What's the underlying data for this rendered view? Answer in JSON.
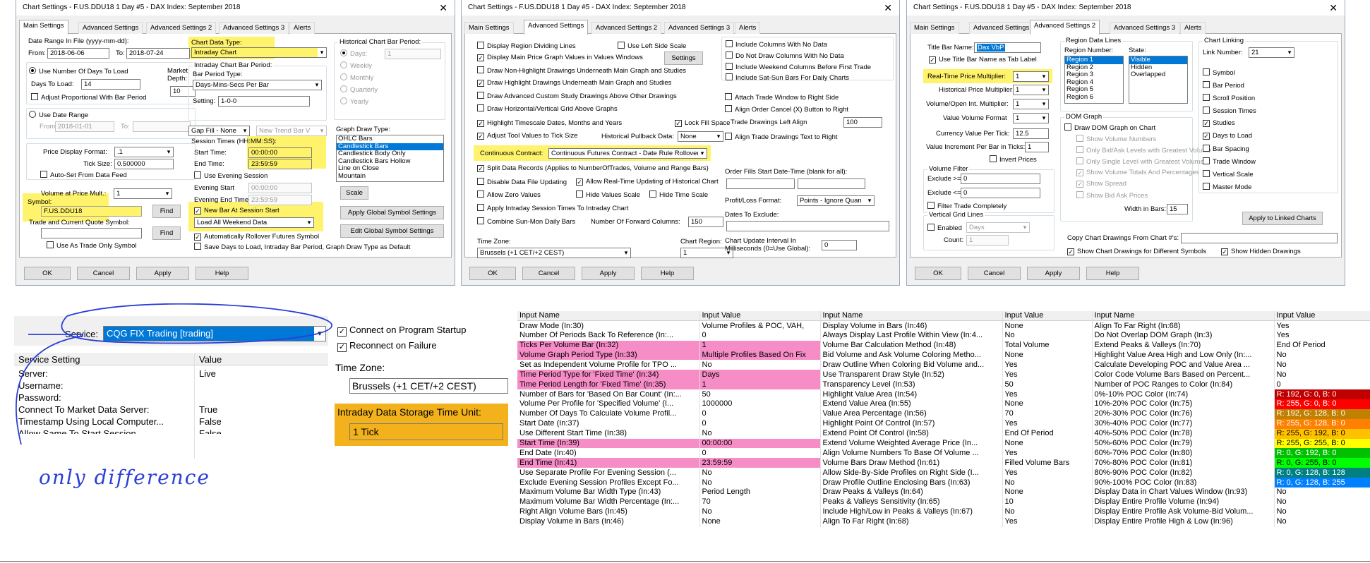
{
  "dialog_title": "Chart Settings - F.US.DDU18  1 Day  #5 - DAX Index: September 2018",
  "close_glyph": "✕",
  "tabs": [
    "Main Settings",
    "Advanced Settings",
    "Advanced Settings 2",
    "Advanced Settings 3",
    "Alerts"
  ],
  "buttons": {
    "ok": "OK",
    "cancel": "Cancel",
    "apply": "Apply",
    "help": "Help"
  },
  "highlight_color": "#fff36b",
  "pink_color": "#f78dc7",
  "d1": {
    "date_range_label": "Date Range In File (yyyy-mm-dd):",
    "from_label": "From:",
    "from_value": "2018-06-06",
    "to_label": "To:",
    "to_value": "2018-07-24",
    "use_days": "Use Number Of Days To Load",
    "days_to_load_label": "Days To Load:",
    "days_to_load": "14",
    "market_depth_label": "Market Depth:",
    "market_depth": "10",
    "adjust_prop": "Adjust Proportional With Bar Period",
    "use_date_range": "Use Date Range",
    "dr_from_label": "From:",
    "dr_from": "2018-01-01",
    "dr_to_label": "To:",
    "price_fmt_label": "Price Display Format:",
    "price_fmt": ".1",
    "tick_size_label": "Tick Size:",
    "tick_size": "0.500000",
    "auto_set": "Auto-Set From Data Feed",
    "vap_label": "Volume at Price Mult.:",
    "vap": "1",
    "symbol_label": "Symbol:",
    "symbol": "F.US.DDU18",
    "find": "Find",
    "trade_quote_label": "Trade and Current Quote Symbol:",
    "use_trade_only": "Use As Trade Only Symbol",
    "chart_data_type_label": "Chart Data Type:",
    "chart_data_type": "Intraday Chart",
    "intraday_period_label": "Intraday Chart Bar Period:",
    "bar_period_type_label": "Bar Period Type:",
    "bar_period_type": "Days-Mins-Secs Per Bar",
    "setting_label": "Setting:",
    "setting": "1-0-0",
    "gap_fill": "Gap Fill - None",
    "new_trend": "New Trend Bar V",
    "session_times_label": "Session Times (HH:MM:SS):",
    "start_time_label": "Start Time:",
    "start_time": "00:00:00",
    "end_time_label": "End Time:",
    "end_time": "23:59:59",
    "use_evening": "Use Evening Session",
    "evening_start_label": "Evening Start",
    "evening_start": "00:00:00",
    "evening_end_label": "Evening End Time:",
    "evening_end": "23:59:59",
    "new_bar": "New Bar At Session Start",
    "load_weekend": "Load All Weekend Data",
    "auto_rollover": "Automatically Rollover Futures Symbol",
    "save_days": "Save Days to Load, Intraday Bar Period, Graph Draw Type as Default",
    "hist_period_label": "Historical Chart Bar Period:",
    "hist_days_label": "Days:",
    "hist_days": "1",
    "hist_weekly": "Weekly",
    "hist_monthly": "Monthly",
    "hist_quarterly": "Quarterly",
    "hist_yearly": "Yearly",
    "graph_draw_label": "Graph Draw Type:",
    "graph_draw_items": [
      "OHLC Bars",
      "Candlestick Bars",
      "Candlestick Body Only",
      "Candlestick Bars Hollow",
      "Line on Close",
      "Mountain"
    ],
    "scale": "Scale",
    "apply_global": "Apply Global Symbol Settings",
    "edit_global": "Edit Global Symbol Settings"
  },
  "d2": {
    "checks": [
      "Display Region Dividing Lines",
      "Use Left Side Scale",
      "Display Main Price Graph Values in Values Windows",
      "Draw Non-Highlight Drawings Underneath Main Graph and Studies",
      "Draw Highlight Drawings Underneath Main Graph and Studies",
      "Draw Advanced Custom Study Drawings Above Other Drawings",
      "Draw Horizontal/Vertical Grid Above Graphs",
      "Highlight Timescale Dates, Months and Years",
      "Lock Fill Space",
      "Adjust Tool Values to Tick Size",
      "Split Data Records (Applies to NumberOfTrades, Volume and Range Bars)",
      "Disable Data File Updating",
      "Allow Real-Time Updating of Historical Chart",
      "Allow Zero Values",
      "Hide Values Scale",
      "Hide Time Scale",
      "Apply Intraday Session Times To Intraday Chart",
      "Combine Sun-Mon Daily Bars"
    ],
    "settings": "Settings",
    "hist_pullback_label": "Historical Pullback Data:",
    "hist_pullback": "None",
    "continuous_label": "Continuous Contract:",
    "continuous": "Continuous Futures Contract - Date Rule Rollover",
    "fwd_cols_label": "Number Of Forward Columns:",
    "fwd_cols": "150",
    "right_checks": [
      "Include Columns With No Data",
      "Do Not Draw Columns With No Data",
      "Include Weekend Columns Before First Trade",
      "Include Sat-Sun Bars For Daily Charts",
      "Attach Trade Window to Right Side",
      "Align Order Cancel (X) Button to Right",
      "Align Trade Drawings Text to Right"
    ],
    "trade_left_label": "Trade Drawings Left Align",
    "trade_left": "100",
    "order_fills_label": "Order Fills Start Date-Time (blank for all):",
    "pl_format_label": "Profit/Loss Format:",
    "pl_format": "Points - Ignore Quan",
    "dates_exclude_label": "Dates To Exclude:",
    "time_zone_label": "Time Zone:",
    "time_zone": "Brussels (+1 CET/+2 CEST)",
    "chart_region_label": "Chart Region:",
    "chart_region": "1",
    "update_interval_label": "Chart Update Interval In Milliseconds (0=Use Global):",
    "update_interval": "0"
  },
  "d3": {
    "title_bar_label": "Title Bar Name:",
    "title_bar": "Dax VbP",
    "use_title_tab": "Use Title Bar Name as Tab Label",
    "rt_mult_label": "Real-Time Price Multiplier:",
    "rt_mult": "1",
    "hist_mult_label": "Historical Price Multiplier:",
    "hist_mult": "1",
    "vol_oi_label": "Volume/Open Int. Multiplier:",
    "vol_oi": "1",
    "vol_fmt_label": "Value Volume Format",
    "vol_fmt": "1",
    "currency_label": "Currency Value Per Tick:",
    "currency": "12.5",
    "vol_inc_label": "Value Increment Per Bar in Ticks:",
    "vol_inc": "1",
    "invert": "Invert Prices",
    "vol_filter_label": "Volume Filter",
    "excl_ge_label": "Exclude >=",
    "excl_ge": "0",
    "excl_le_label": "Exclude <=",
    "excl_le": "0",
    "filter_complete": "Filter Trade Completely",
    "vgrid_label": "Vertical Grid Lines",
    "enabled": "Enabled",
    "vg_days": "Days",
    "count_label": "Count:",
    "count": "1",
    "region_lines_label": "Region Data Lines",
    "region_number_label": "Region Number:",
    "regions": [
      "Region 1",
      "Region 2",
      "Region 3",
      "Region 4",
      "Region 5",
      "Region 6"
    ],
    "state_label": "State:",
    "states": [
      "Visible",
      "Hidden",
      "Overlapped"
    ],
    "dom_graph_label": "DOM Graph",
    "dom_checks": [
      "Draw DOM Graph on Chart",
      "Show Volume Numbers",
      "Only Bid/Ask Levels with Greatest Volume",
      "Only Single Level with Greatest Volume",
      "Show Volume Totals And Percentages",
      "Show Spread",
      "Show Bid Ask Prices"
    ],
    "width_label": "Width in Bars:",
    "width": "15",
    "linking_label": "Chart Linking",
    "link_number_label": "Link Number:",
    "link_number": "21",
    "link_checks": [
      "Symbol",
      "Bar Period",
      "Scroll Position",
      "Session Times",
      "Studies",
      "Days to Load",
      "Bar Spacing",
      "Trade Window",
      "Vertical Scale",
      "Master Mode"
    ],
    "apply_linked": "Apply to Linked Charts",
    "copy_label": "Copy Chart Drawings From Chart #'s:",
    "show_diff": "Show Chart Drawings for Different Symbols",
    "show_hidden": "Show Hidden Drawings"
  },
  "service": {
    "service_label": "Service:",
    "service_value": "CQG FIX Trading   [trading]",
    "col1": "Service Setting",
    "col2": "Value",
    "rows": [
      [
        "Server:",
        "Live"
      ],
      [
        "Username:",
        ""
      ],
      [
        "Password:",
        ""
      ],
      [
        "Connect To Market Data Server:",
        "True"
      ],
      [
        "Timestamp Using Local Computer...",
        "False"
      ],
      [
        "Allow Same To Start Session",
        "False"
      ]
    ],
    "connect_startup": "Connect on Program Startup",
    "reconnect": "Reconnect on Failure",
    "tz_label": "Time Zone:",
    "tz_value": "Brussels (+1 CET/+2 CEST)",
    "storage_label": "Intraday Data Storage Time Unit:",
    "storage_value": "1 Tick",
    "storage_color": "#f3b21b",
    "annotation": "only difference"
  },
  "inputs": {
    "headers": [
      "Input Name",
      "Input Value",
      "Input Name",
      "Input Value",
      "Input Name",
      "Input Value"
    ],
    "col1": [
      [
        "Draw Mode  (In:30)",
        "Volume Profiles & POC, VAH,"
      ],
      [
        "Number Of Periods Back To Reference  (In:...",
        "0"
      ],
      [
        "Ticks Per Volume Bar  (In:32)",
        "1"
      ],
      [
        "Volume Graph Period Type  (In:33)",
        "Multiple Profiles Based On Fix"
      ],
      [
        "Set as Independent Volume Profile for TPO ...",
        "No"
      ],
      [
        "Time Period Type for 'Fixed Time'  (In:34)",
        "Days"
      ],
      [
        "Time Period Length for 'Fixed Time'  (In:35)",
        "1"
      ],
      [
        "Number of Bars for 'Based On Bar Count'  (In:...",
        "50"
      ],
      [
        "Volume Per Profile for 'Specified Volume'  (I...",
        "1000000"
      ],
      [
        "Number Of Days To Calculate Volume Profil...",
        "0"
      ],
      [
        "Start Date  (In:37)",
        "0"
      ],
      [
        "Use Different Start Time  (In:38)",
        "No"
      ],
      [
        "Start Time  (In:39)",
        "00:00:00"
      ],
      [
        "End Date  (In:40)",
        "0"
      ],
      [
        "End Time  (In:41)",
        "23:59:59"
      ],
      [
        "Use Separate Profile For Evening Session  (...",
        "No"
      ],
      [
        "Exclude Evening Session Profiles Except Fo...",
        "No"
      ],
      [
        "Maximum Volume Bar Width Type  (In:43)",
        "Period Length"
      ],
      [
        "Maximum Volume Bar Width Percentage  (In:...",
        "70"
      ],
      [
        "Right Align Volume Bars  (In:45)",
        "No"
      ],
      [
        "Display Volume in Bars  (In:46)",
        "None"
      ]
    ],
    "col2": [
      [
        "Display Volume in Bars  (In:46)",
        "None"
      ],
      [
        "Always Display Last Profile Within View  (In:4...",
        "No"
      ],
      [
        "Volume Bar Calculation Method  (In:48)",
        "Total Volume"
      ],
      [
        "Bid Volume and Ask Volume Coloring Metho...",
        "None"
      ],
      [
        "Draw Outline When Coloring Bid Volume and...",
        "Yes"
      ],
      [
        "Use Transparent Draw Style  (In:52)",
        "Yes"
      ],
      [
        "Transparency Level  (In:53)",
        "50"
      ],
      [
        "Highlight Value Area  (In:54)",
        "Yes"
      ],
      [
        "Extend Value Area  (In:55)",
        "None"
      ],
      [
        "Value Area Percentage  (In:56)",
        "70"
      ],
      [
        "Highlight Point Of Control  (In:57)",
        "Yes"
      ],
      [
        "Extend Point Of Control  (In:58)",
        "End Of Period"
      ],
      [
        "Extend Volume Weighted Average Price  (In...",
        "None"
      ],
      [
        "Align Volume Numbers To Base Of Volume ...",
        "Yes"
      ],
      [
        "Volume Bars Draw Method  (In:61)",
        "Filled Volume Bars"
      ],
      [
        "Allow Side-By-Side Profiles on Right Side  (I...",
        "Yes"
      ],
      [
        "Draw Profile Outline Enclosing Bars  (In:63)",
        "No"
      ],
      [
        "Draw Peaks & Valleys  (In:64)",
        "None"
      ],
      [
        "Peaks & Valleys Sensitivity  (In:65)",
        "10"
      ],
      [
        "Include High/Low in Peaks & Valleys  (In:67)",
        "No"
      ],
      [
        "Align To Far Right  (In:68)",
        "Yes"
      ]
    ],
    "col3": [
      [
        "Align To Far Right  (In:68)",
        "Yes"
      ],
      [
        "Do Not Overlap DOM Graph  (In:3)",
        "Yes"
      ],
      [
        "Extend Peaks & Valleys  (In:70)",
        "End Of Period"
      ],
      [
        "Highlight Value Area High and Low Only  (In:...",
        "No"
      ],
      [
        "Calculate Developing POC and Value Area ...",
        "No"
      ],
      [
        "Color Code Volume Bars Based on Percent...",
        "No"
      ],
      [
        "Number of POC Ranges to Color  (In:84)",
        "0"
      ],
      [
        "0%-10% POC Color  (In:74)",
        "R: 192, G: 0, B: 0"
      ],
      [
        "10%-20% POC Color  (In:75)",
        "R: 255, G: 0, B: 0"
      ],
      [
        "20%-30% POC Color  (In:76)",
        "R: 192, G: 128, B: 0"
      ],
      [
        "30%-40% POC Color  (In:77)",
        "R: 255, G: 128, B: 0"
      ],
      [
        "40%-50% POC Color  (In:78)",
        "R: 255, G: 192, B: 0"
      ],
      [
        "50%-60% POC Color  (In:79)",
        "R: 255, G: 255, B: 0"
      ],
      [
        "60%-70% POC Color  (In:80)",
        "R: 0, G: 192, B: 0"
      ],
      [
        "70%-80% POC Color  (In:81)",
        "R: 0, G: 255, B: 0"
      ],
      [
        "80%-90% POC Color  (In:82)",
        "R: 0, G: 128, B: 128"
      ],
      [
        "90%-100% POC Color  (In:83)",
        "R: 0, G: 128, B: 255"
      ],
      [
        "Display Data in Chart Values Window  (In:93)",
        "No"
      ],
      [
        "Display Entire Profile Volume  (In:94)",
        "No"
      ],
      [
        "Display Entire Profile Ask Volume-Bid Volum...",
        "No"
      ],
      [
        "Display Entire Profile High & Low  (In:96)",
        "No"
      ]
    ],
    "pink_rows": [
      2,
      3,
      5,
      6,
      12,
      14
    ],
    "poc_colors": [
      "#c00000",
      "#ff0000",
      "#c08000",
      "#ff8000",
      "#ffc000",
      "#ffff00",
      "#00c000",
      "#00ff00",
      "#008080",
      "#0080ff"
    ],
    "poc_text_colors": [
      "#ffffff",
      "#ffffff",
      "#ffffff",
      "#ffffff",
      "#000000",
      "#000000",
      "#ffffff",
      "#000000",
      "#ffffff",
      "#ffffff"
    ]
  }
}
